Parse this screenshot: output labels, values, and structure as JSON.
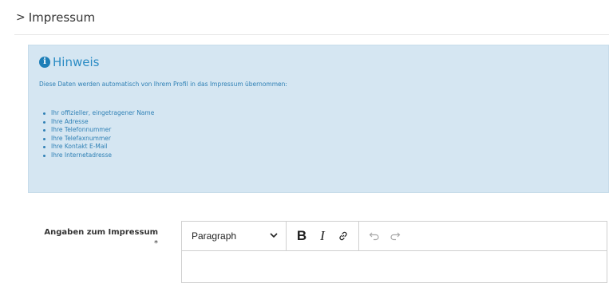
{
  "section": {
    "chevron": ">",
    "title": "Impressum"
  },
  "notice": {
    "icon": "info-circle-icon",
    "title": "Hinweis",
    "text": "Diese Daten werden automatisch von Ihrem Profil in das Impressum übernommen:",
    "items": [
      "Ihr offizieller, eingetragener Name",
      "Ihre Adresse",
      "Ihre Telefonnummer",
      "Ihre Telefaxnummer",
      "Ihre Kontakt E-Mail",
      "Ihre Internetadresse"
    ],
    "colors": {
      "background": "#d5e6f2",
      "text": "#2f80b5"
    }
  },
  "field": {
    "label": "Angaben zum Impressum",
    "required_marker": "*"
  },
  "editor": {
    "block_format": "Paragraph",
    "toolbar": {
      "bold_label": "B",
      "italic_label": "I",
      "link_icon": "link-icon",
      "undo_icon": "undo-icon",
      "redo_icon": "redo-icon"
    },
    "content": ""
  }
}
